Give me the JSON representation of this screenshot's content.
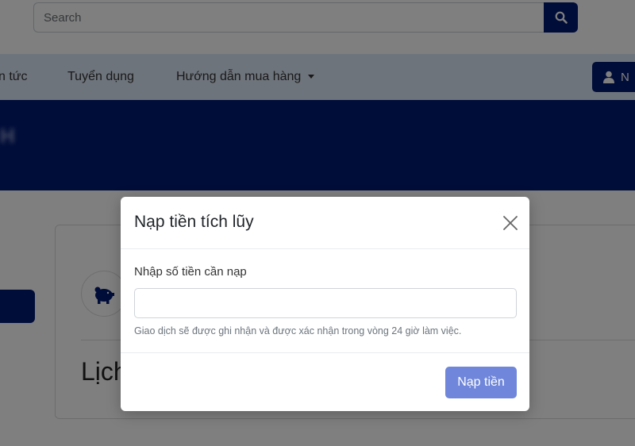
{
  "search": {
    "placeholder": "Search"
  },
  "nav": {
    "items": [
      {
        "label": "n tức"
      },
      {
        "label": "Tuyển dụng"
      },
      {
        "label": "Hướng dẫn mua hàng"
      }
    ],
    "login_label": "N"
  },
  "banner": {
    "title": "H"
  },
  "card": {
    "heading": "Lịch"
  },
  "modal": {
    "title": "Nạp tiền tích lũy",
    "field_label": "Nhập số tiền cần nạp",
    "amount_value": "",
    "help_text": "Giao dịch sẽ được ghi nhận và được xác nhận trong vòng 24 giờ làm việc.",
    "submit_label": "Nạp tiền"
  },
  "colors": {
    "brand_navy": "#021a72",
    "nav_bg": "#dde8f8",
    "submit_bg": "#6f86da"
  },
  "icons": {
    "search": "search-icon",
    "user": "user-icon",
    "piggy": "piggy-bank-icon",
    "close": "close-icon",
    "caret": "chevron-down-icon"
  }
}
